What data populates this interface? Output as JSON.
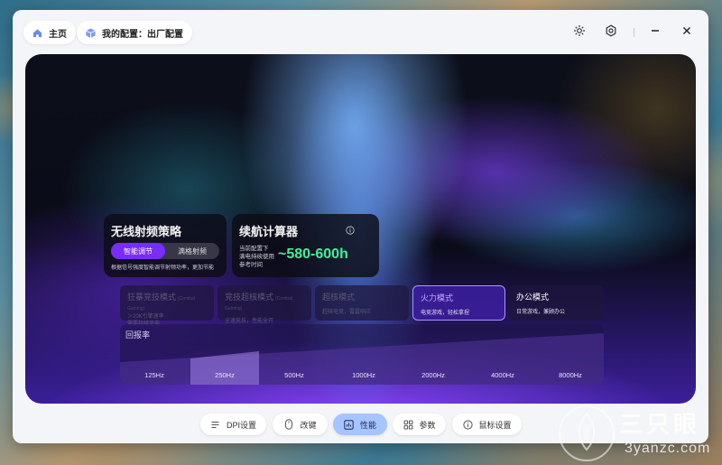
{
  "titlebar": {
    "home_label": "主页",
    "config_label": "我的配置：出厂配置"
  },
  "rf_card": {
    "title": "无线射频策略",
    "options": [
      "智能调节",
      "满格射频"
    ],
    "selected": "智能调节",
    "description": "根据信号强度智能调节射频功率，更加节能"
  },
  "battery_card": {
    "title": "续航计算器",
    "desc_lines": [
      "当前配置下",
      "满电持续使用",
      "参考时间"
    ],
    "value": "~580-600h"
  },
  "modes": [
    {
      "title": "狂暴竞技模式",
      "subtitle_en": "(Combat Gaming)",
      "desc_lines": [
        "＞20K引擎速率",
        "需要持续充电"
      ]
    },
    {
      "title": "竞技超核模式",
      "subtitle_en": "(Combat Gaming)",
      "desc_lines": [
        "全速竞技，性能全开"
      ]
    },
    {
      "title": "超核模式",
      "subtitle_en": "",
      "desc_lines": [
        "超核电竞，雷霆响应"
      ]
    },
    {
      "title": "火力模式",
      "subtitle_en": "",
      "desc_lines": [
        "电竞游戏，轻松拿捏"
      ]
    },
    {
      "title": "办公模式",
      "subtitle_en": "",
      "desc_lines": [
        "日常游戏，兼顾办公"
      ]
    }
  ],
  "active_mode": "火力模式",
  "polling_rate": {
    "label": "回报率",
    "options": [
      "125Hz",
      "250Hz",
      "500Hz",
      "1000Hz",
      "2000Hz",
      "4000Hz",
      "8000Hz"
    ],
    "selected": "250Hz"
  },
  "bottom_nav": [
    {
      "label": "DPI设置",
      "icon": "dpi-icon"
    },
    {
      "label": "改键",
      "icon": "mouse-icon"
    },
    {
      "label": "性能",
      "icon": "chart-icon"
    },
    {
      "label": "参数",
      "icon": "grid-icon"
    },
    {
      "label": "鼠标设置",
      "icon": "info-icon"
    }
  ],
  "active_nav": "性能",
  "watermark": {
    "text": "三只眼",
    "url": "3yanzc.com"
  }
}
